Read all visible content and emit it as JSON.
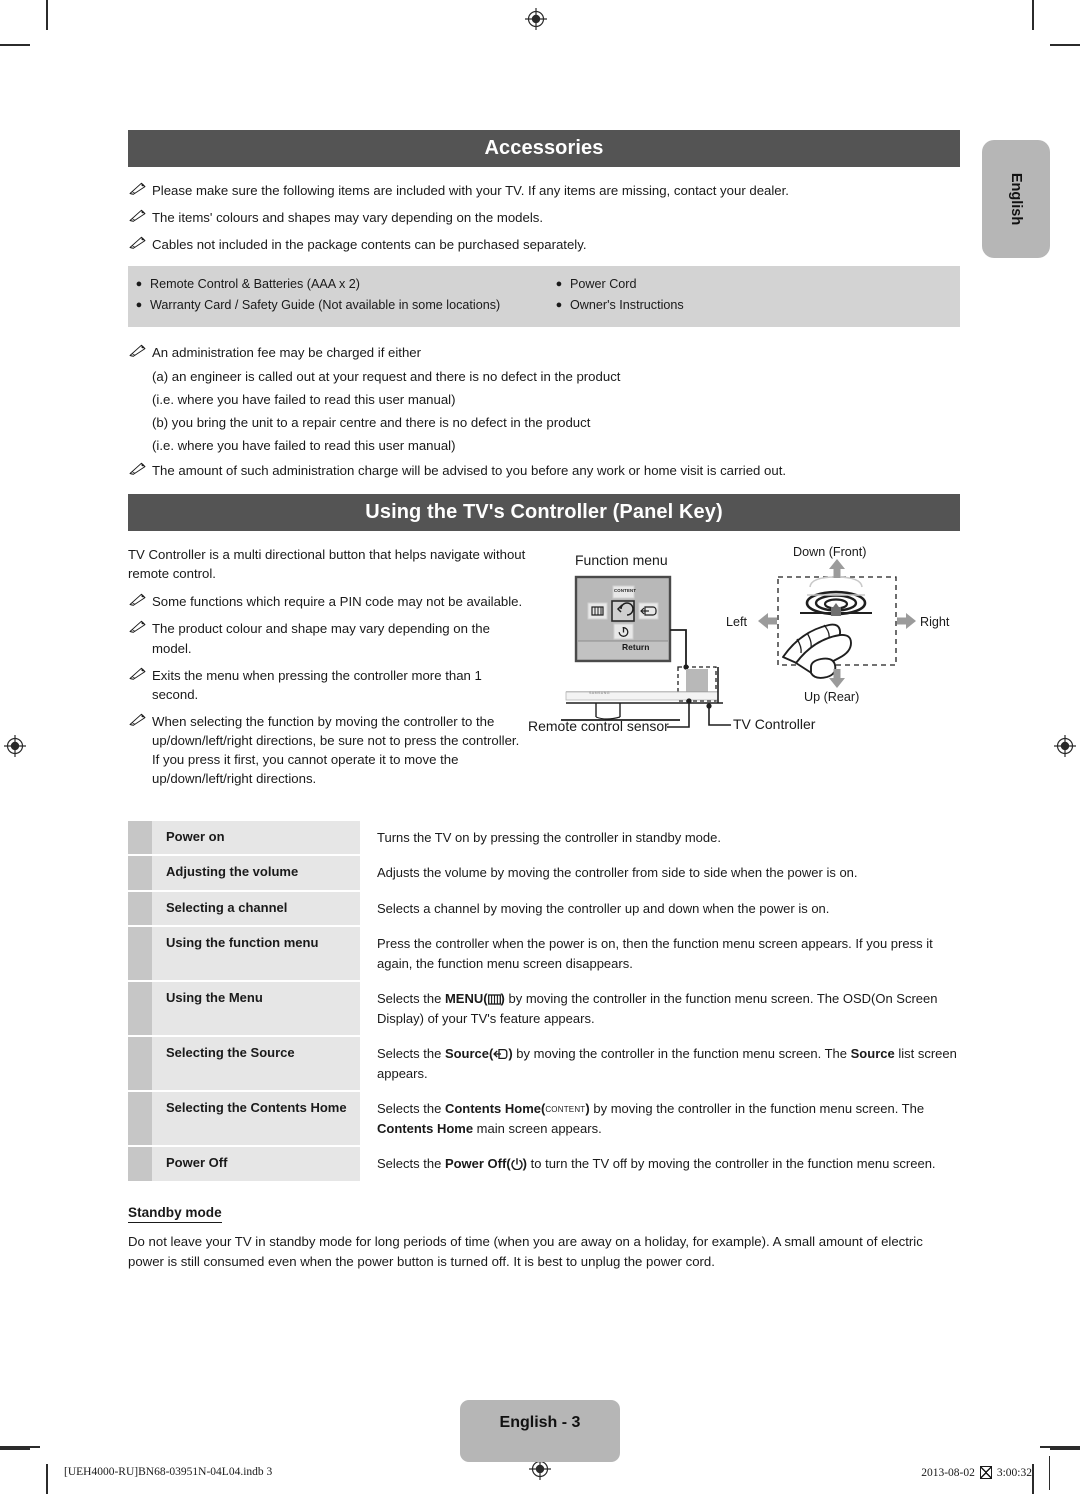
{
  "sections": {
    "accessories": {
      "title": "Accessories",
      "notes": [
        "Please make sure the following items are included with your TV. If any items are missing, contact your dealer.",
        "The items' colours and shapes may vary depending on the models.",
        "Cables not included in the package contents can be purchased separately."
      ],
      "box_left": [
        "Remote Control & Batteries (AAA x 2)",
        "Warranty Card / Safety Guide (Not available in some locations)"
      ],
      "box_right": [
        "Power Cord",
        "Owner's Instructions"
      ],
      "fee_note": "An administration fee may be charged if either",
      "fee_lines": [
        "(a) an engineer is called out at your request and there is no defect in the product",
        "(i.e. where you have failed to read this user manual)",
        "(b) you bring the unit to a repair centre and there is no defect in the product",
        "(i.e. where you have failed to read this user manual)"
      ],
      "charge_note": "The amount of such administration charge will be advised to you before any work or home visit is carried out."
    },
    "controller": {
      "title": "Using the TV's Controller (Panel Key)",
      "intro": "TV Controller is a multi directional button that helps navigate without remote control.",
      "notes": [
        "Some functions which require a PIN code may not be available.",
        "The product colour and shape may vary depending on the model.",
        "Exits the menu when pressing the controller more than 1 second.",
        "When selecting the function by moving the controller to the up/down/left/right directions, be sure not to press the controller. If you press it first, you cannot operate it to move the up/down/left/right directions."
      ],
      "diagram": {
        "function_menu_label": "Function menu",
        "return_label": "Return",
        "content_key_label": "CONTENT",
        "remote_sensor_label": "Remote control sensor",
        "tv_controller_label": "TV Controller",
        "brand_label": "SAMSUNG",
        "down_label": "Down (Front)",
        "up_label": "Up (Rear)",
        "left_label": "Left",
        "right_label": "Right"
      },
      "table": [
        {
          "label": "Power on",
          "desc_parts": [
            {
              "t": "Turns the TV on by pressing the controller in standby mode."
            }
          ]
        },
        {
          "label": "Adjusting the volume",
          "desc_parts": [
            {
              "t": "Adjusts the volume by moving the controller from side to side when the power is on."
            }
          ]
        },
        {
          "label": "Selecting a channel",
          "desc_parts": [
            {
              "t": "Selects a channel by moving the controller up and down when the power is on."
            }
          ]
        },
        {
          "label": "Using the function menu",
          "desc_parts": [
            {
              "t": "Press the controller when the power is on, then the function menu screen appears. If you press it again, the function menu screen disappears."
            }
          ]
        },
        {
          "label": "Using the Menu",
          "desc_parts": [
            {
              "t": "Selects the "
            },
            {
              "t": "MENU(",
              "b": true
            },
            {
              "icon": "menu-icon"
            },
            {
              "t": ")",
              "b": true
            },
            {
              "t": " by moving the controller in the function menu screen. The OSD(On Screen Display) of your TV's feature appears."
            }
          ]
        },
        {
          "label": "Selecting the Source",
          "desc_parts": [
            {
              "t": "Selects the "
            },
            {
              "t": "Source(",
              "b": true
            },
            {
              "icon": "source-icon"
            },
            {
              "t": ")",
              "b": true
            },
            {
              "t": " by moving the controller in the function menu screen. The "
            },
            {
              "t": "Source",
              "b": true
            },
            {
              "t": " list screen appears."
            }
          ]
        },
        {
          "label": "Selecting the Contents Home",
          "desc_parts": [
            {
              "t": "Selects the "
            },
            {
              "t": "Contents Home(",
              "b": true
            },
            {
              "t": "CONTENT",
              "kw": true
            },
            {
              "t": ")",
              "b": true
            },
            {
              "t": " by moving the controller in the function menu screen. The "
            },
            {
              "t": "Contents Home",
              "b": true
            },
            {
              "t": " main screen appears."
            }
          ]
        },
        {
          "label": "Power Off",
          "desc_parts": [
            {
              "t": "Selects the "
            },
            {
              "t": "Power Off(",
              "b": true
            },
            {
              "icon": "power-icon"
            },
            {
              "t": ")",
              "b": true
            },
            {
              "t": " to turn the TV off by moving the controller in the function menu screen."
            }
          ]
        }
      ]
    },
    "standby": {
      "title": "Standby mode",
      "body": "Do not leave your TV in standby mode for long periods of time (when you are away on a holiday, for example). A small amount of electric power is still consumed even when the power button is turned off. It is best to unplug the power cord."
    }
  },
  "side_tab": {
    "label": "English"
  },
  "footer": {
    "page_label": "English - 3",
    "file_ref": "[UEH4000-RU]BN68-03951N-04L04.indb   3",
    "date": "2013-08-02",
    "time": "3:00:32"
  },
  "colors": {
    "bar": "#545454",
    "box_gray": "#d3d3d3",
    "label_gray": "#e6e6e6",
    "gutter_gray": "#c6c6c6",
    "tab_gray": "#b6b6b6"
  }
}
